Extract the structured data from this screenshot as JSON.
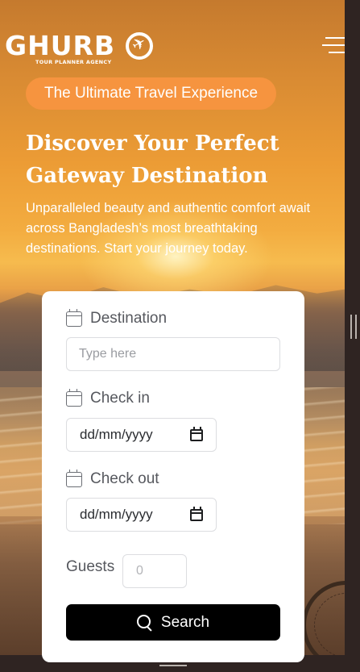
{
  "header": {
    "logo_text": "GHURB",
    "logo_subtitle": "TOUR PLANNER AGENCY"
  },
  "hero": {
    "badge": "The Ultimate Travel Experience",
    "title": "Discover Your Perfect Gateway Destination",
    "description": "Unparalleled beauty and authentic comfort await across Bangladesh’s most breathtaking destinations. Start your journey today."
  },
  "search_form": {
    "destination": {
      "label": "Destination",
      "placeholder": "Type here",
      "value": ""
    },
    "check_in": {
      "label": "Check in",
      "value": "dd/mm/yyyy"
    },
    "check_out": {
      "label": "Check out",
      "value": "dd/mm/yyyy"
    },
    "guests": {
      "label": "Guests",
      "placeholder": "0",
      "value": ""
    },
    "submit_label": "Search"
  },
  "colors": {
    "badge": "#f6943f",
    "button": "#000000",
    "card": "#ffffff",
    "label_text": "#56585e"
  }
}
